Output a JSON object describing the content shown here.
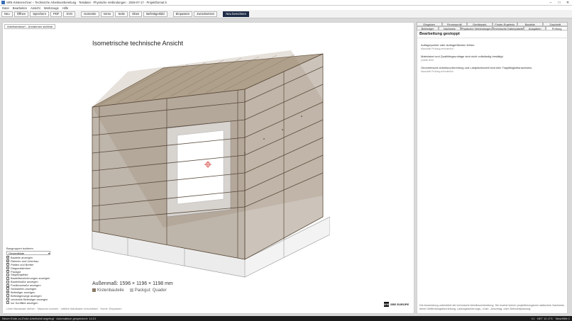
{
  "window": {
    "title": "SRE Kistenrechner – Technische Arbeitsvorbereitung · Testdatei · Physische Verbindungen · 2026-07-17 · Projektformat 5",
    "controls": [
      "–",
      "□",
      "✕"
    ]
  },
  "menu": [
    "Datei",
    "Bearbeiten",
    "Ansicht",
    "Werkzeuge",
    "Hilfe"
  ],
  "toolbar": {
    "group1": [
      "Neu",
      "Öffnen",
      "Speichern",
      "PDF",
      "SVG"
    ],
    "group2": [
      "Isometrie",
      "Vorne",
      "Seite",
      "Oben",
      "Befestigerbild"
    ],
    "group3": [
      "Einpassen",
      "Zurücksetzen"
    ],
    "primary": "Neu berechnen"
  },
  "viewport": {
    "tab_label": "Arbeitsentwurf – Annahmen sichtbar",
    "title": "Isometrische technische Ansicht",
    "dims": "Außenmaß: 1596 × 1196 × 1198 mm",
    "legend": [
      {
        "label": "Kistenbauteile",
        "color": "#8a7a66"
      },
      {
        "label": "Packgut: Quader",
        "color": "#bdbdbd"
      }
    ],
    "hint": "Linke Maustaste drehen · Mausrad zoomen · mittlere Maustaste verschieben · Home: Einpassen"
  },
  "groups": {
    "heading": "Baugruppen isolieren",
    "select": "Gesamtkiste",
    "items": [
      {
        "label": "Bauteile anzeigen",
        "checked": true
      },
      {
        "label": "Rahmen und Unterbau",
        "checked": true
      },
      {
        "label": "Platten und Bretter",
        "checked": true
      },
      {
        "label": "Diagonalstreben",
        "checked": true
      },
      {
        "label": "Packgut",
        "checked": true
      },
      {
        "label": "Stapelzapfbild",
        "checked": false
      },
      {
        "label": "Bauteilbezeichnungen anzeigen",
        "checked": false
      },
      {
        "label": "Bauteilmaße anzeigen",
        "checked": false
      },
      {
        "label": "Positionsmaße anzeigen",
        "checked": false
      },
      {
        "label": "Stoßstellen anzeigen",
        "checked": false
      },
      {
        "label": "Befestiger anzeigen",
        "checked": true
      },
      {
        "label": "Befestigerwege anzeigen",
        "checked": false
      },
      {
        "label": "verdeckte Befestiger anzeigen",
        "checked": false
      },
      {
        "label": "nur Konflikte anzeigen",
        "checked": false
      }
    ]
  },
  "brand": {
    "icon": "SRE",
    "name": "SRE EUROPE"
  },
  "panel": {
    "tabs_top": [
      "Eingaben",
      "Firmenprofil",
      "Gerätepark",
      "Finder-Ergebnis",
      "Bauteile",
      "Zuschnitt"
    ],
    "tabs_bottom": [
      "Befestiger",
      "Nachweis",
      "Physische Verbindungen",
      "Technische Datenpakete",
      "Ausgaben",
      "Prüfung"
    ],
    "active_tab": "Prüfung",
    "heading": "Bearbeitung gestoppt",
    "messages": [
      {
        "text": "Auflagepunkte oder Auflagerflächen fehlen.",
        "sub": "Manuelle Prüfung erforderlich"
      },
      {
        "text": "Materialart und Qualitätsgrundlage sind nicht vollständig bestätigt.",
        "sub": "Quelle fehlt"
      },
      {
        "text": "Geometrische Arbeitsvorbereitung und Lastpfadmodell sind kein Tragfähigkeitsnachweis.",
        "sub": "Manuelle Prüfung erforderlich"
      }
    ],
    "footer": "Die Anwendung unterstützt die technische Arbeitsvorbereitung. Sie ersetzt keinen projektbezogenen statischen Nachweis, keine Gefährdungsbeurteilung, Ladungssicherungs-, Kran-, Anschlag- oder Zielmarktplanung."
  },
  "status": {
    "left": "Neuer Ende-zu-Ende-Arbeitsfall angelegt · Automatisch gespeichert: 14:21",
    "right": "V1 · NET 10 LTS · Tabs/Hilfe 1"
  },
  "colors": {
    "wood": "#8a7a66",
    "wood_light": "#b8aa97",
    "primary_button": "#1d2b45",
    "status_bar": "#1b1b1b"
  }
}
